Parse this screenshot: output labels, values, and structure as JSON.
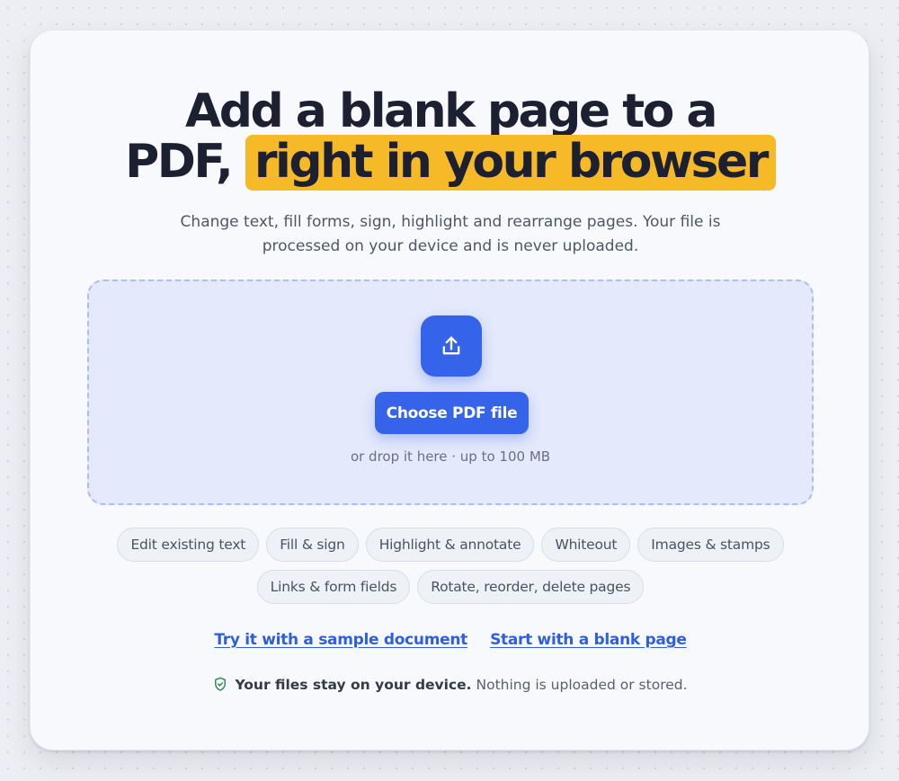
{
  "headline": {
    "line1": "Add a blank page to a",
    "line2_plain": "PDF,",
    "line2_highlight": "right in your browser"
  },
  "subtitle": {
    "line1": "Change text, fill forms, sign, highlight and rearrange pages. Your file is",
    "line2": "processed on your device and is never uploaded."
  },
  "dropzone": {
    "icon": "upload-icon",
    "button_label": "Choose PDF file",
    "hint": "or drop it here · up to 100 MB"
  },
  "features": [
    "Edit existing text",
    "Fill & sign",
    "Highlight & annotate",
    "Whiteout",
    "Images & stamps",
    "Links & form fields",
    "Rotate, reorder, delete pages"
  ],
  "links": {
    "sample": "Try it with a sample document",
    "blank": "Start with a blank page"
  },
  "privacy": {
    "icon": "shield-check-icon",
    "bold": "Your files stay on your device.",
    "rest": "Nothing is uploaded or stored."
  },
  "colors": {
    "accent": "#3563e9",
    "highlight": "#f6b928",
    "shield": "#2e8b57"
  }
}
